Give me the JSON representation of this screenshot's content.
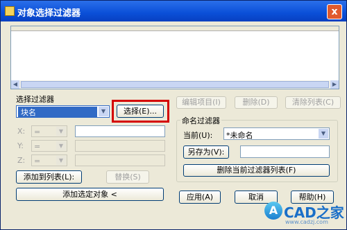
{
  "window": {
    "title": "对象选择过滤器",
    "close_glyph": "x"
  },
  "filter_select": {
    "label": "选择过滤器",
    "type_value": "块名",
    "select_button": "选择(E)...",
    "x_label": "X:",
    "y_label": "Y:",
    "z_label": "Z:",
    "operator_value": "=",
    "add_to_list_button": "添加到列表(L):",
    "replace_button": "替换(S)",
    "add_selected_button": "添加选定对象 <"
  },
  "list_actions": {
    "edit_item": "编辑项目(I)",
    "delete": "删除(D)",
    "clear_list": "清除列表(C)"
  },
  "named_filters": {
    "label": "命名过滤器",
    "current_label": "当前(U):",
    "current_value": "*未命名",
    "save_as_button": "另存为(V):",
    "save_as_value": "",
    "delete_current_button": "删除当前过滤器列表(F)"
  },
  "footer": {
    "apply": "应用(A)",
    "cancel": "取消",
    "help": "帮助(H)"
  },
  "watermark": {
    "text": "CAD之家",
    "badge": "A",
    "url": "www.cadzj.com"
  },
  "colors": {
    "title_bar": "#0a4fd8",
    "highlight": "#d40000",
    "selection": "#316ac5"
  }
}
